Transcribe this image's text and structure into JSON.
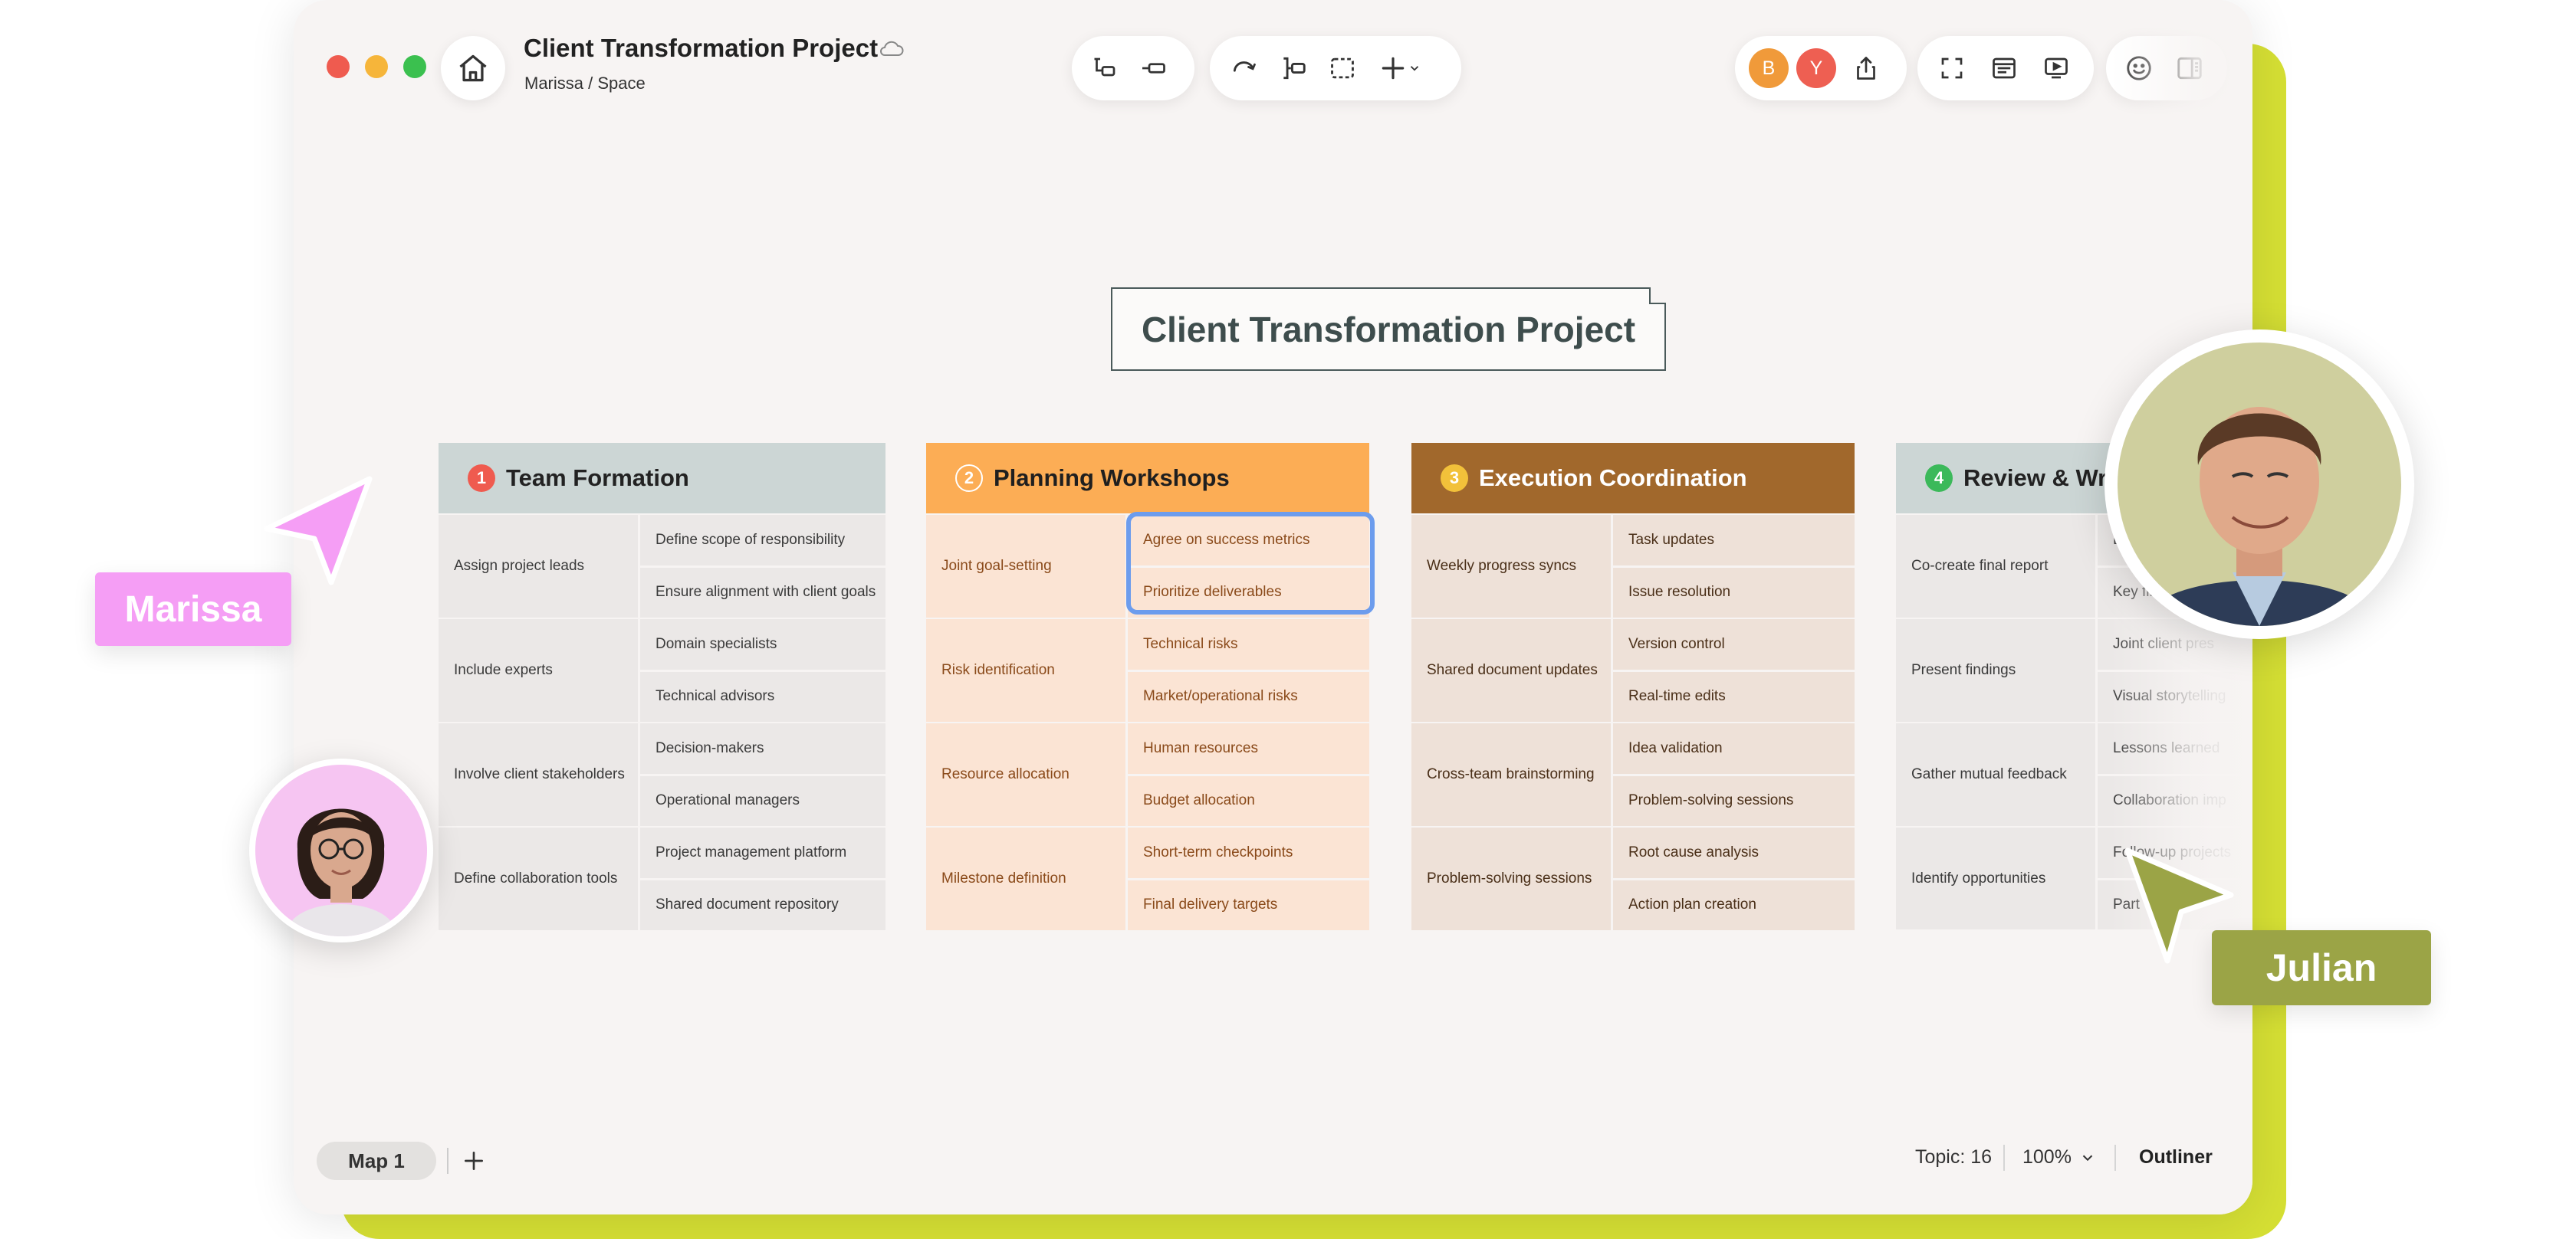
{
  "window": {
    "title": "Client Transformation Project",
    "path": "Marissa / Space"
  },
  "toolbar": {
    "center_icons": [
      "subtopic-icon",
      "topic-icon",
      "relationship-icon",
      "summary-icon",
      "boundary-icon",
      "insert-icon"
    ],
    "collaborators": [
      {
        "initial": "B",
        "color": "#f09a3a"
      },
      {
        "initial": "Y",
        "color": "#ee5f52"
      }
    ],
    "right_icons": [
      "share-icon",
      "fullscreen-icon",
      "outline-icon",
      "present-icon",
      "emoji-icon",
      "sidebar-icon"
    ]
  },
  "canvas": {
    "central_topic": "Client Transformation Project",
    "columns": [
      {
        "number": "1",
        "title": "Team Formation",
        "groups": [
          {
            "label": "Assign project leads",
            "items": [
              "Define scope of responsibility",
              "Ensure alignment with client goals"
            ]
          },
          {
            "label": "Include experts",
            "items": [
              "Domain specialists",
              "Technical advisors"
            ]
          },
          {
            "label": "Involve client stakeholders",
            "items": [
              "Decision-makers",
              "Operational managers"
            ]
          },
          {
            "label": "Define collaboration tools",
            "items": [
              "Project management platform",
              "Shared document repository"
            ]
          }
        ]
      },
      {
        "number": "2",
        "title": "Planning Workshops",
        "groups": [
          {
            "label": "Joint goal-setting",
            "items": [
              "Agree on success metrics",
              "Prioritize deliverables"
            ]
          },
          {
            "label": "Risk identification",
            "items": [
              "Technical risks",
              "Market/operational risks"
            ]
          },
          {
            "label": "Resource allocation",
            "items": [
              "Human resources",
              "Budget allocation"
            ]
          },
          {
            "label": "Milestone definition",
            "items": [
              "Short-term checkpoints",
              "Final delivery targets"
            ]
          }
        ]
      },
      {
        "number": "3",
        "title": "Execution Coordination",
        "groups": [
          {
            "label": "Weekly progress syncs",
            "items": [
              "Task updates",
              "Issue resolution"
            ]
          },
          {
            "label": "Shared document updates",
            "items": [
              "Version control",
              "Real-time edits"
            ]
          },
          {
            "label": "Cross-team brainstorming",
            "items": [
              "Idea validation",
              "Problem-solving sessions"
            ]
          },
          {
            "label": "Problem-solving sessions",
            "items": [
              "Root cause analysis",
              "Action plan creation"
            ]
          }
        ]
      },
      {
        "number": "4",
        "title": "Review & Wrap",
        "groups": [
          {
            "label": "Co-create final report",
            "items": [
              "Ex",
              "Key fin"
            ]
          },
          {
            "label": "Present findings",
            "items": [
              "Joint client pres",
              "Visual storytelling"
            ]
          },
          {
            "label": "Gather mutual feedback",
            "items": [
              "Lessons learned",
              "Collaboration imp"
            ]
          },
          {
            "label": "Identify opportunities",
            "items": [
              "Follow-up projects",
              "Part"
            ]
          }
        ]
      }
    ]
  },
  "footer": {
    "map_tab": "Map 1",
    "topic_count": "Topic: 16",
    "zoom": "100%",
    "outliner": "Outliner"
  },
  "collaborators_cursors": {
    "marissa": "Marissa",
    "julian": "Julian"
  },
  "colors": {
    "accent_lime": "#d5df34",
    "marissa_pink": "#f59ef5",
    "julian_olive": "#9ba446",
    "selection_blue": "#6c9ced"
  }
}
